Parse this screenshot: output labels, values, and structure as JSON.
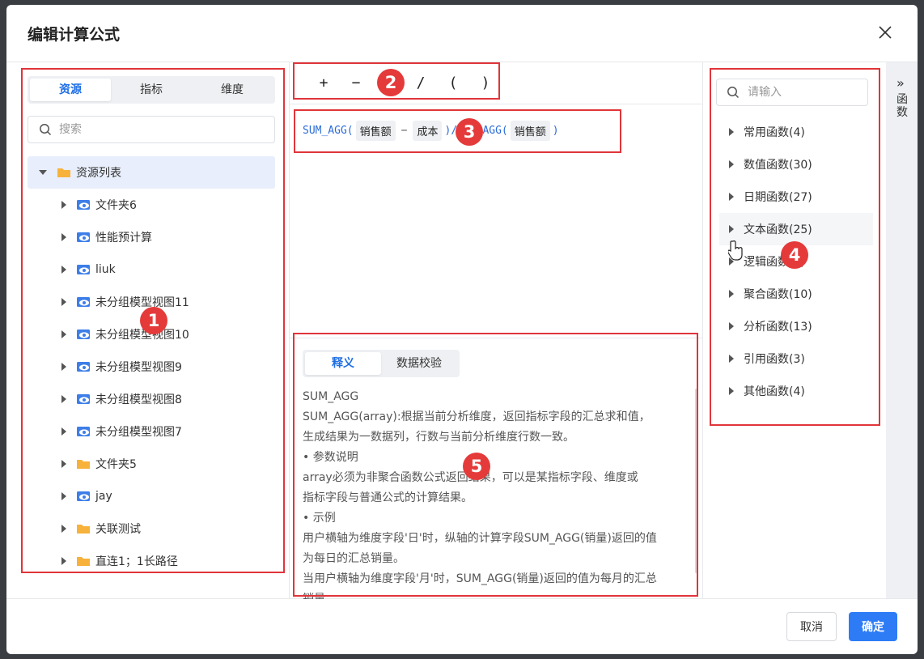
{
  "dialog": {
    "title": "编辑计算公式",
    "close_icon": "close-icon"
  },
  "left": {
    "tabs": [
      {
        "label": "资源",
        "active": true
      },
      {
        "label": "指标",
        "active": false
      },
      {
        "label": "维度",
        "active": false
      }
    ],
    "search_placeholder": "搜索",
    "tree_root": "资源列表",
    "tree_items": [
      {
        "label": "文件夹6",
        "icon": "model-view-icon"
      },
      {
        "label": "性能预计算",
        "icon": "model-view-icon"
      },
      {
        "label": "liuk",
        "icon": "model-view-icon"
      },
      {
        "label": "未分组模型视图11",
        "icon": "model-view-icon"
      },
      {
        "label": "未分组模型视图10",
        "icon": "model-view-icon"
      },
      {
        "label": "未分组模型视图9",
        "icon": "model-view-icon"
      },
      {
        "label": "未分组模型视图8",
        "icon": "model-view-icon"
      },
      {
        "label": "未分组模型视图7",
        "icon": "model-view-icon"
      },
      {
        "label": "文件夹5",
        "icon": "folder-icon"
      },
      {
        "label": "jay",
        "icon": "model-view-icon"
      },
      {
        "label": "关联测试",
        "icon": "folder-icon"
      },
      {
        "label": "直连1；1长路径",
        "icon": "folder-icon"
      }
    ]
  },
  "operators": [
    "+",
    "−",
    "×",
    "/",
    "(",
    ")"
  ],
  "formula": {
    "fn1": "SUM_AGG(",
    "field1": "销售额",
    "minus": "−",
    "field2": "成本",
    "close1": ")",
    "slash": "/",
    "fn2": "SUM_AGG(",
    "field3": "销售额",
    "close2": ")"
  },
  "desc": {
    "tabs": [
      {
        "label": "释义",
        "active": true
      },
      {
        "label": "数据校验",
        "active": false
      }
    ],
    "lines": [
      "SUM_AGG",
      "SUM_AGG(array):根据当前分析维度，返回指标字段的汇总求和值，",
      "生成结果为一数据列，行数与当前分析维度行数一致。",
      "• 参数说明",
      "array必须为非聚合函数公式返回结果，可以是某指标字段、维度或",
      "指标字段与普通公式的计算结果。",
      "• 示例",
      "用户横轴为维度字段'日'时，纵轴的计算字段SUM_AGG(销量)返回的值",
      "为每日的汇总销量。",
      "当用户横轴为维度字段'月'时，SUM_AGG(销量)返回的值为每月的汇总",
      "销量"
    ]
  },
  "functions": {
    "search_placeholder": "请输入",
    "items": [
      "常用函数(4)",
      "数值函数(30)",
      "日期函数(27)",
      "文本函数(25)",
      "逻辑函数(6)",
      "聚合函数(10)",
      "分析函数(13)",
      "引用函数(3)",
      "其他函数(4)"
    ]
  },
  "side_rail": {
    "arrow": "»",
    "label": "函数"
  },
  "footer": {
    "cancel": "取消",
    "ok": "确定"
  },
  "annotations": [
    "1",
    "2",
    "3",
    "4",
    "5"
  ],
  "colors": {
    "accent": "#2d7cf6",
    "annotation": "#e53a3a",
    "formula_fn": "#2b6cd8"
  }
}
